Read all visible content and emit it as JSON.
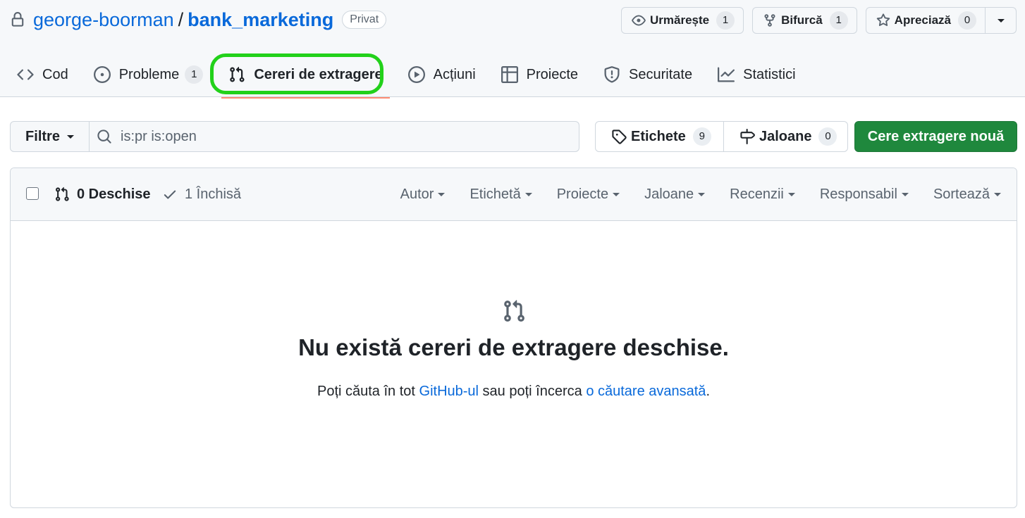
{
  "repo": {
    "owner": "george-boorman",
    "separator": "/",
    "name": "bank_marketing",
    "visibility": "Privat"
  },
  "actions": {
    "watch": {
      "label": "Urmărește",
      "count": "1"
    },
    "fork": {
      "label": "Bifurcă",
      "count": "1"
    },
    "star": {
      "label": "Apreciază",
      "count": "0"
    }
  },
  "tabs": [
    {
      "label": "Cod",
      "icon": "code-icon"
    },
    {
      "label": "Probleme",
      "count": "1",
      "icon": "issue-icon"
    },
    {
      "label": "Cereri de extragere",
      "icon": "pull-request-icon",
      "selected": true
    },
    {
      "label": "Acțiuni",
      "icon": "play-icon"
    },
    {
      "label": "Proiecte",
      "icon": "table-icon"
    },
    {
      "label": "Securitate",
      "icon": "shield-icon"
    },
    {
      "label": "Statistici",
      "icon": "graph-icon"
    }
  ],
  "highlight_color": "#22d11a",
  "toolbar": {
    "filters_label": "Filtre",
    "search_value": "is:pr is:open",
    "labels": {
      "label": "Etichete",
      "count": "9"
    },
    "milestones": {
      "label": "Jaloane",
      "count": "0"
    },
    "new_pr_label": "Cere extragere nouă",
    "new_pr_color": "#1f883d"
  },
  "list": {
    "open_label": "0 Deschise",
    "closed_label": "1 Închisă",
    "sort_filters": [
      "Autor",
      "Etichetă",
      "Proiecte",
      "Jaloane",
      "Recenzii",
      "Responsabil",
      "Sortează"
    ]
  },
  "blankslate": {
    "title": "Nu există cereri de extragere deschise.",
    "desc_before": "Poți căuta în tot ",
    "desc_link1": "GitHub-ul",
    "desc_middle": " sau poți încerca ",
    "desc_link2": "o căutare avansată",
    "desc_after": "."
  },
  "link_color": "#0969da"
}
